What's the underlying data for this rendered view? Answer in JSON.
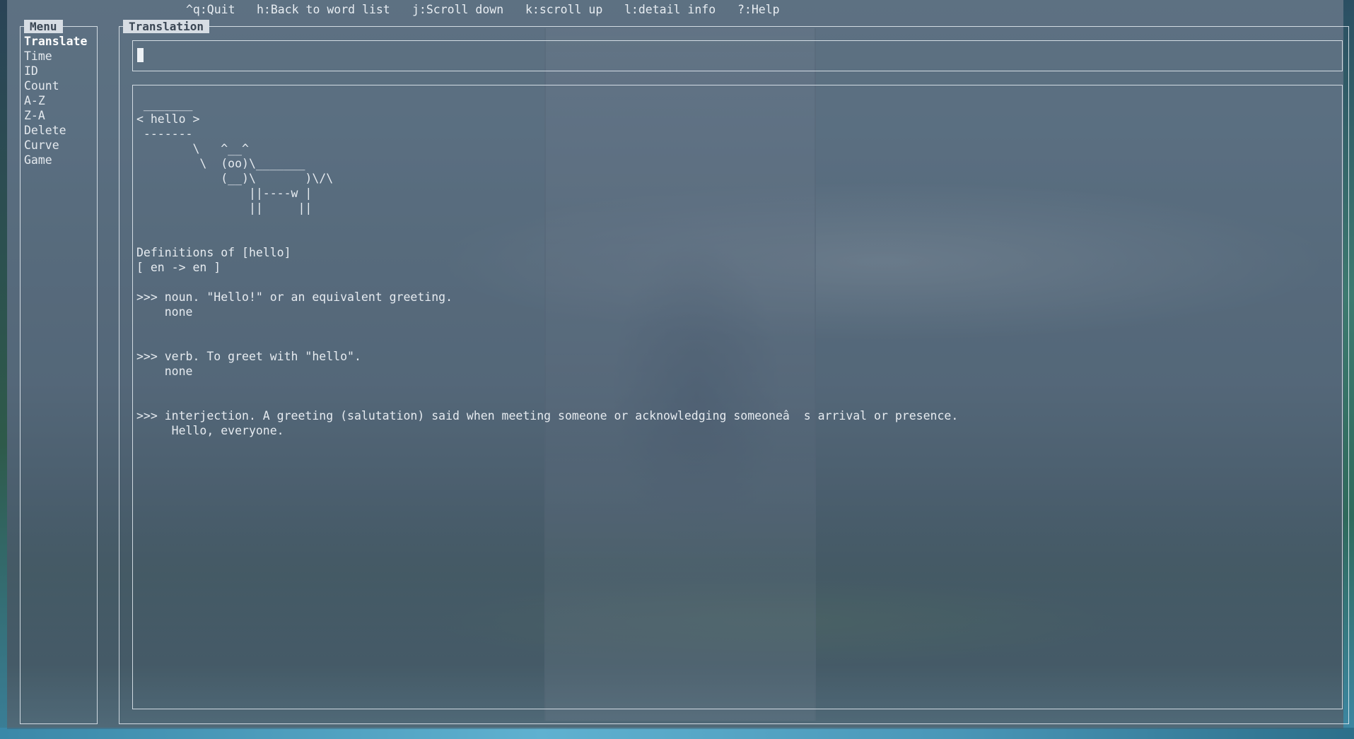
{
  "keybar": [
    {
      "key": "^q",
      "label": "Quit"
    },
    {
      "key": "h",
      "label": "Back to word list"
    },
    {
      "key": "j",
      "label": "Scroll down"
    },
    {
      "key": "k",
      "label": "scroll up"
    },
    {
      "key": "l",
      "label": "detail info"
    },
    {
      "key": "?",
      "label": "Help"
    }
  ],
  "keybar_text": [
    "^q:Quit",
    "h:Back to word list",
    "j:Scroll down",
    "k:scroll up",
    "l:detail info",
    "?:Help"
  ],
  "menu": {
    "title": "Menu",
    "items": [
      "Translate",
      "Time",
      "ID",
      "Count",
      "A-Z",
      "Z-A",
      "Delete",
      "Curve",
      "Game"
    ],
    "active": "Translate"
  },
  "translation": {
    "title": "Translation",
    "input_value": "",
    "cowsay": " _______\n< hello >\n -------\n        \\   ^__^\n         \\  (oo)\\_______\n            (__)\\       )\\/\\\n                ||----w |\n                ||     ||",
    "definitions_header": "Definitions of [hello]",
    "language_pair": "[ en -> en ]",
    "entries": [
      {
        "line": ">>> noun. \"Hello!\" or an equivalent greeting.",
        "example": "    none"
      },
      {
        "line": ">>> verb. To greet with \"hello\".",
        "example": "    none"
      },
      {
        "line": ">>> interjection. A greeting (salutation) said when meeting someone or acknowledging someoneâ  s arrival or presence.",
        "example": "     Hello, everyone."
      }
    ]
  },
  "colors": {
    "text": "#e6ebf0",
    "title_bg": "#d7dde4",
    "title_fg": "#3a4654",
    "border": "#e8eef4"
  }
}
